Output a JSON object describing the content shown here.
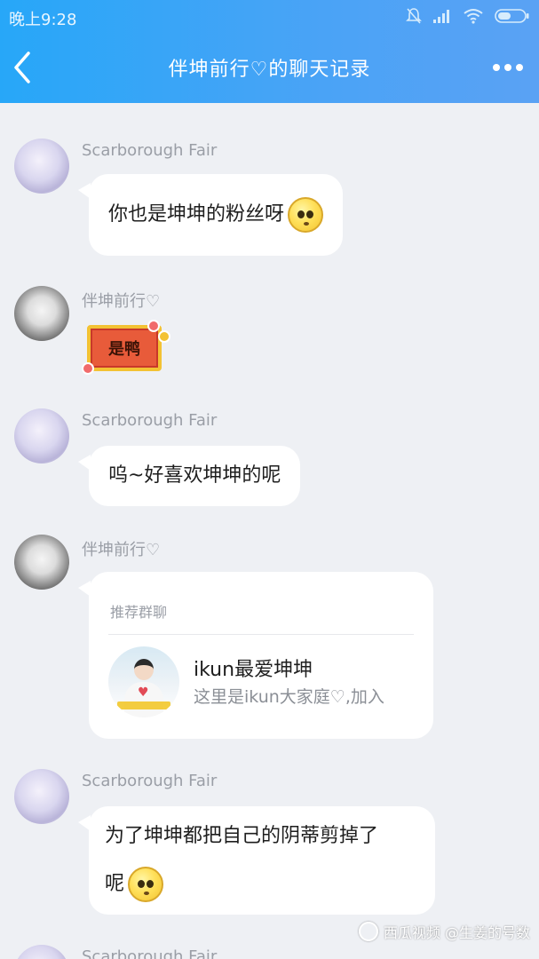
{
  "status_bar": {
    "time": "晚上9:28"
  },
  "header": {
    "title": "伴坤前行♡的聊天记录"
  },
  "messages": [
    {
      "sender": "Scarborough Fair",
      "text": "你也是坤坤的粉丝呀"
    },
    {
      "sender": "伴坤前行♡",
      "sticker_text": "是鸭"
    },
    {
      "sender": "Scarborough Fair",
      "text": "呜~好喜欢坤坤的呢"
    },
    {
      "sender": "伴坤前行♡",
      "card": {
        "label": "推荐群聊",
        "group_name": "ikun最爱坤坤",
        "group_desc": "这里是ikun大家庭♡,加入"
      }
    },
    {
      "sender": "Scarborough Fair",
      "text_line1": "为了坤坤都把自己的阴蒂剪掉了",
      "text_line2": "呢"
    },
    {
      "sender": "Scarborough Fair"
    }
  ],
  "watermark": {
    "text": "西瓜视频 @生姜的号数"
  },
  "colors": {
    "header_start": "#27a7f8",
    "header_end": "#5aa2f4",
    "background": "#eef0f4",
    "bubble": "#ffffff"
  },
  "icons": [
    "back-icon",
    "more-icon",
    "mute-icon",
    "signal-icon",
    "wifi-icon",
    "battery-icon",
    "smile-emoji-icon"
  ]
}
